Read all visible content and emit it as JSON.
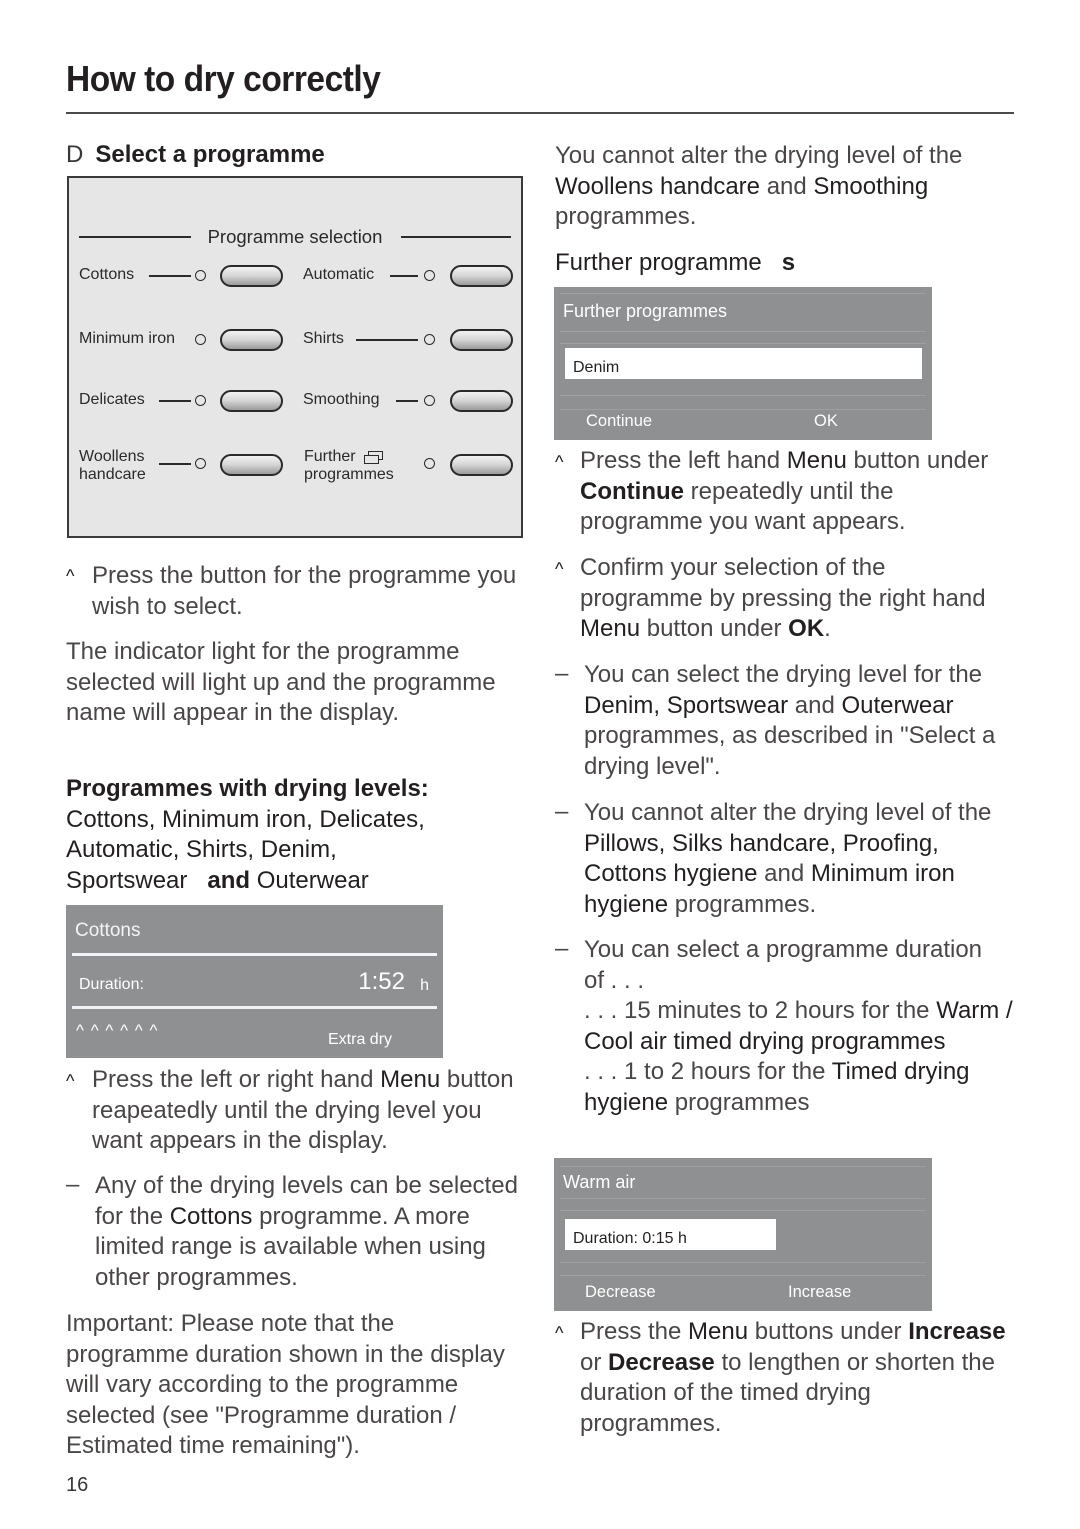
{
  "page": {
    "title": "How to dry correctly",
    "page_number": "16"
  },
  "left": {
    "step_letter": "D",
    "step_title": "Select a programme",
    "panel": {
      "heading": "Programme selection",
      "programmes": [
        {
          "label_line1": "Cottons",
          "label_line2": ""
        },
        {
          "label_line1": "Automatic",
          "label_line2": ""
        },
        {
          "label_line1": "Minimum iron",
          "label_line2": ""
        },
        {
          "label_line1": "Shirts",
          "label_line2": ""
        },
        {
          "label_line1": "Delicates",
          "label_line2": ""
        },
        {
          "label_line1": "Smoothing",
          "label_line2": ""
        },
        {
          "label_line1": "Woollens",
          "label_line2": "handcare"
        },
        {
          "label_line1": "Further",
          "label_line2": "programmes",
          "icon": "multi-page-icon"
        }
      ]
    },
    "bullet_symbol": "^",
    "dash_symbol": "–",
    "instr1": "Press the button for the programme you wish to select.",
    "para1": "The indicator light for the programme selected will light up and the programme name will appear in the display.",
    "levels_heading": "Programmes with drying levels:",
    "levels_list": {
      "a": "Cottons, Minimum iron, Delicates,",
      "b": "Automatic, Shirts, Denim,",
      "c": "Sportswear",
      "and": "and",
      "d": "Outerwear"
    },
    "display_cottons": {
      "programme": "Cottons",
      "duration_label": "Duration:",
      "duration_value": "1:52",
      "duration_unit": "h",
      "level_indicators": "^ ^ ^ ^ ^ ^",
      "level_name": "Extra dry"
    },
    "instr2": {
      "pre": "Press the left or right hand ",
      "menu": "Menu",
      "post": " button reapeatedly until the drying level you want appears in the display."
    },
    "note1": {
      "pre": "Any of the drying levels can be selected for the ",
      "cottons": "Cottons",
      "post": " programme. A more limited range is available when using other programmes."
    },
    "important": "Important: Please note that the programme duration shown in the display will vary according to the programme selected (see \"Programme duration / Estimated time remaining\")."
  },
  "right": {
    "para_top": {
      "pre": "You cannot alter the drying level of the ",
      "woollens": "Woollens handcare",
      "mid": " and ",
      "smoothing": "Smoothing",
      "post": " programmes."
    },
    "further_heading": {
      "text": "Further programme",
      "s": "s"
    },
    "display_further": {
      "title": "Further programmes",
      "selected": "Denim",
      "left_button": "Continue",
      "right_button": "OK"
    },
    "instr1": {
      "pre": "Press the left hand ",
      "menu": "Menu",
      "mid": " button under ",
      "continue": "Continue",
      "post": " repeatedly until the programme you want appears."
    },
    "instr2": {
      "pre": "Confirm your selection of the programme by pressing the right hand ",
      "menu": "Menu",
      "mid": " button under ",
      "ok": "OK",
      "post": "."
    },
    "note1": {
      "pre": "You can select the drying level for the ",
      "progs": "Denim, Sportswear",
      "and": " and ",
      "outer": "Outerwear",
      "post": " programmes, as described in \"Select a drying level\"."
    },
    "note2": {
      "pre": "You cannot alter the drying level of the ",
      "progs": "Pillows, Silks handcare, Proofing, Cottons hygiene",
      "and": " and ",
      "min": "Minimum iron hygiene",
      "post": " programmes."
    },
    "note3": {
      "line1": "You can select a programme duration of . . .",
      "range1_pre": ". . . 15 minutes to 2 hours for the ",
      "range1_prog": "Warm / Cool air timed drying programmes",
      "range2_pre": ". . . 1 to 2 hours for the ",
      "range2_prog": "Timed drying hygiene",
      "range2_post": " programmes"
    },
    "display_warm": {
      "title": "Warm air",
      "duration": "Duration: 0:15  h",
      "left_button": "Decrease",
      "right_button": "Increase"
    },
    "instr3": {
      "pre": "Press the ",
      "menu": "Menu",
      "mid": " buttons under ",
      "inc": "Increase",
      "or": " or ",
      "dec": "Decrease",
      "post": " to lengthen or shorten the duration of the timed drying programmes."
    }
  }
}
